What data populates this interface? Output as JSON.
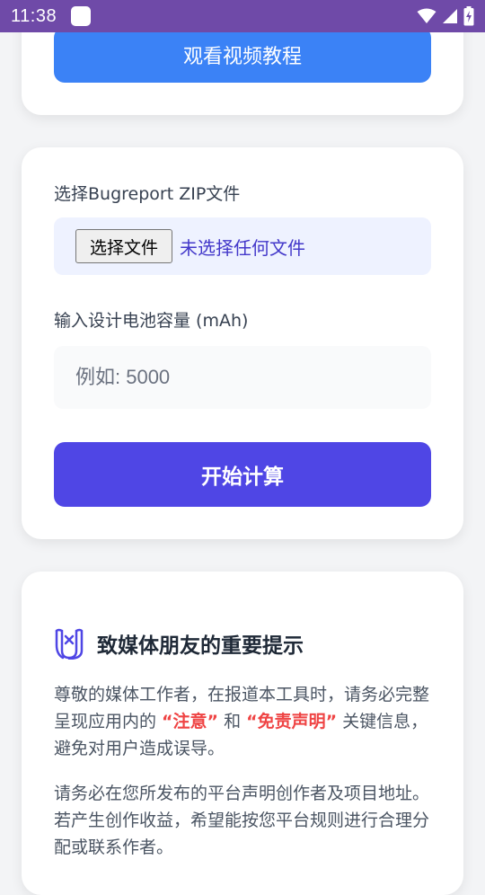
{
  "status_bar": {
    "time": "11:38"
  },
  "video_card": {
    "button_label": "观看视频教程"
  },
  "form": {
    "zip_label": "选择Bugreport ZIP文件",
    "file_button_label": "选择文件",
    "file_status": "未选择任何文件",
    "capacity_label": "输入设计电池容量 (mAh)",
    "capacity_placeholder": "例如: 5000",
    "calculate_label": "开始计算"
  },
  "notice": {
    "title": "致媒体朋友的重要提示",
    "para1_a": "尊敬的媒体工作者，在报道本工具时，请务必完整呈现应用内的 ",
    "highlight1": "“注意”",
    "para1_b": " 和 ",
    "highlight2": "“免责声明”",
    "para1_c": " 关键信息，避免对用户造成误导。",
    "para2": "请务必在您所发布的平台声明创作者及项目地址。若产生创作收益，希望能按您平台规则进行合理分配或联系作者。"
  },
  "colors": {
    "status_bar": "#6f4aa8",
    "video_button": "#3b82f6",
    "calculate_button": "#4f46e5",
    "highlight": "#ef4444"
  },
  "icons": [
    "wifi-icon",
    "signal-icon",
    "battery-icon",
    "media-icon"
  ]
}
